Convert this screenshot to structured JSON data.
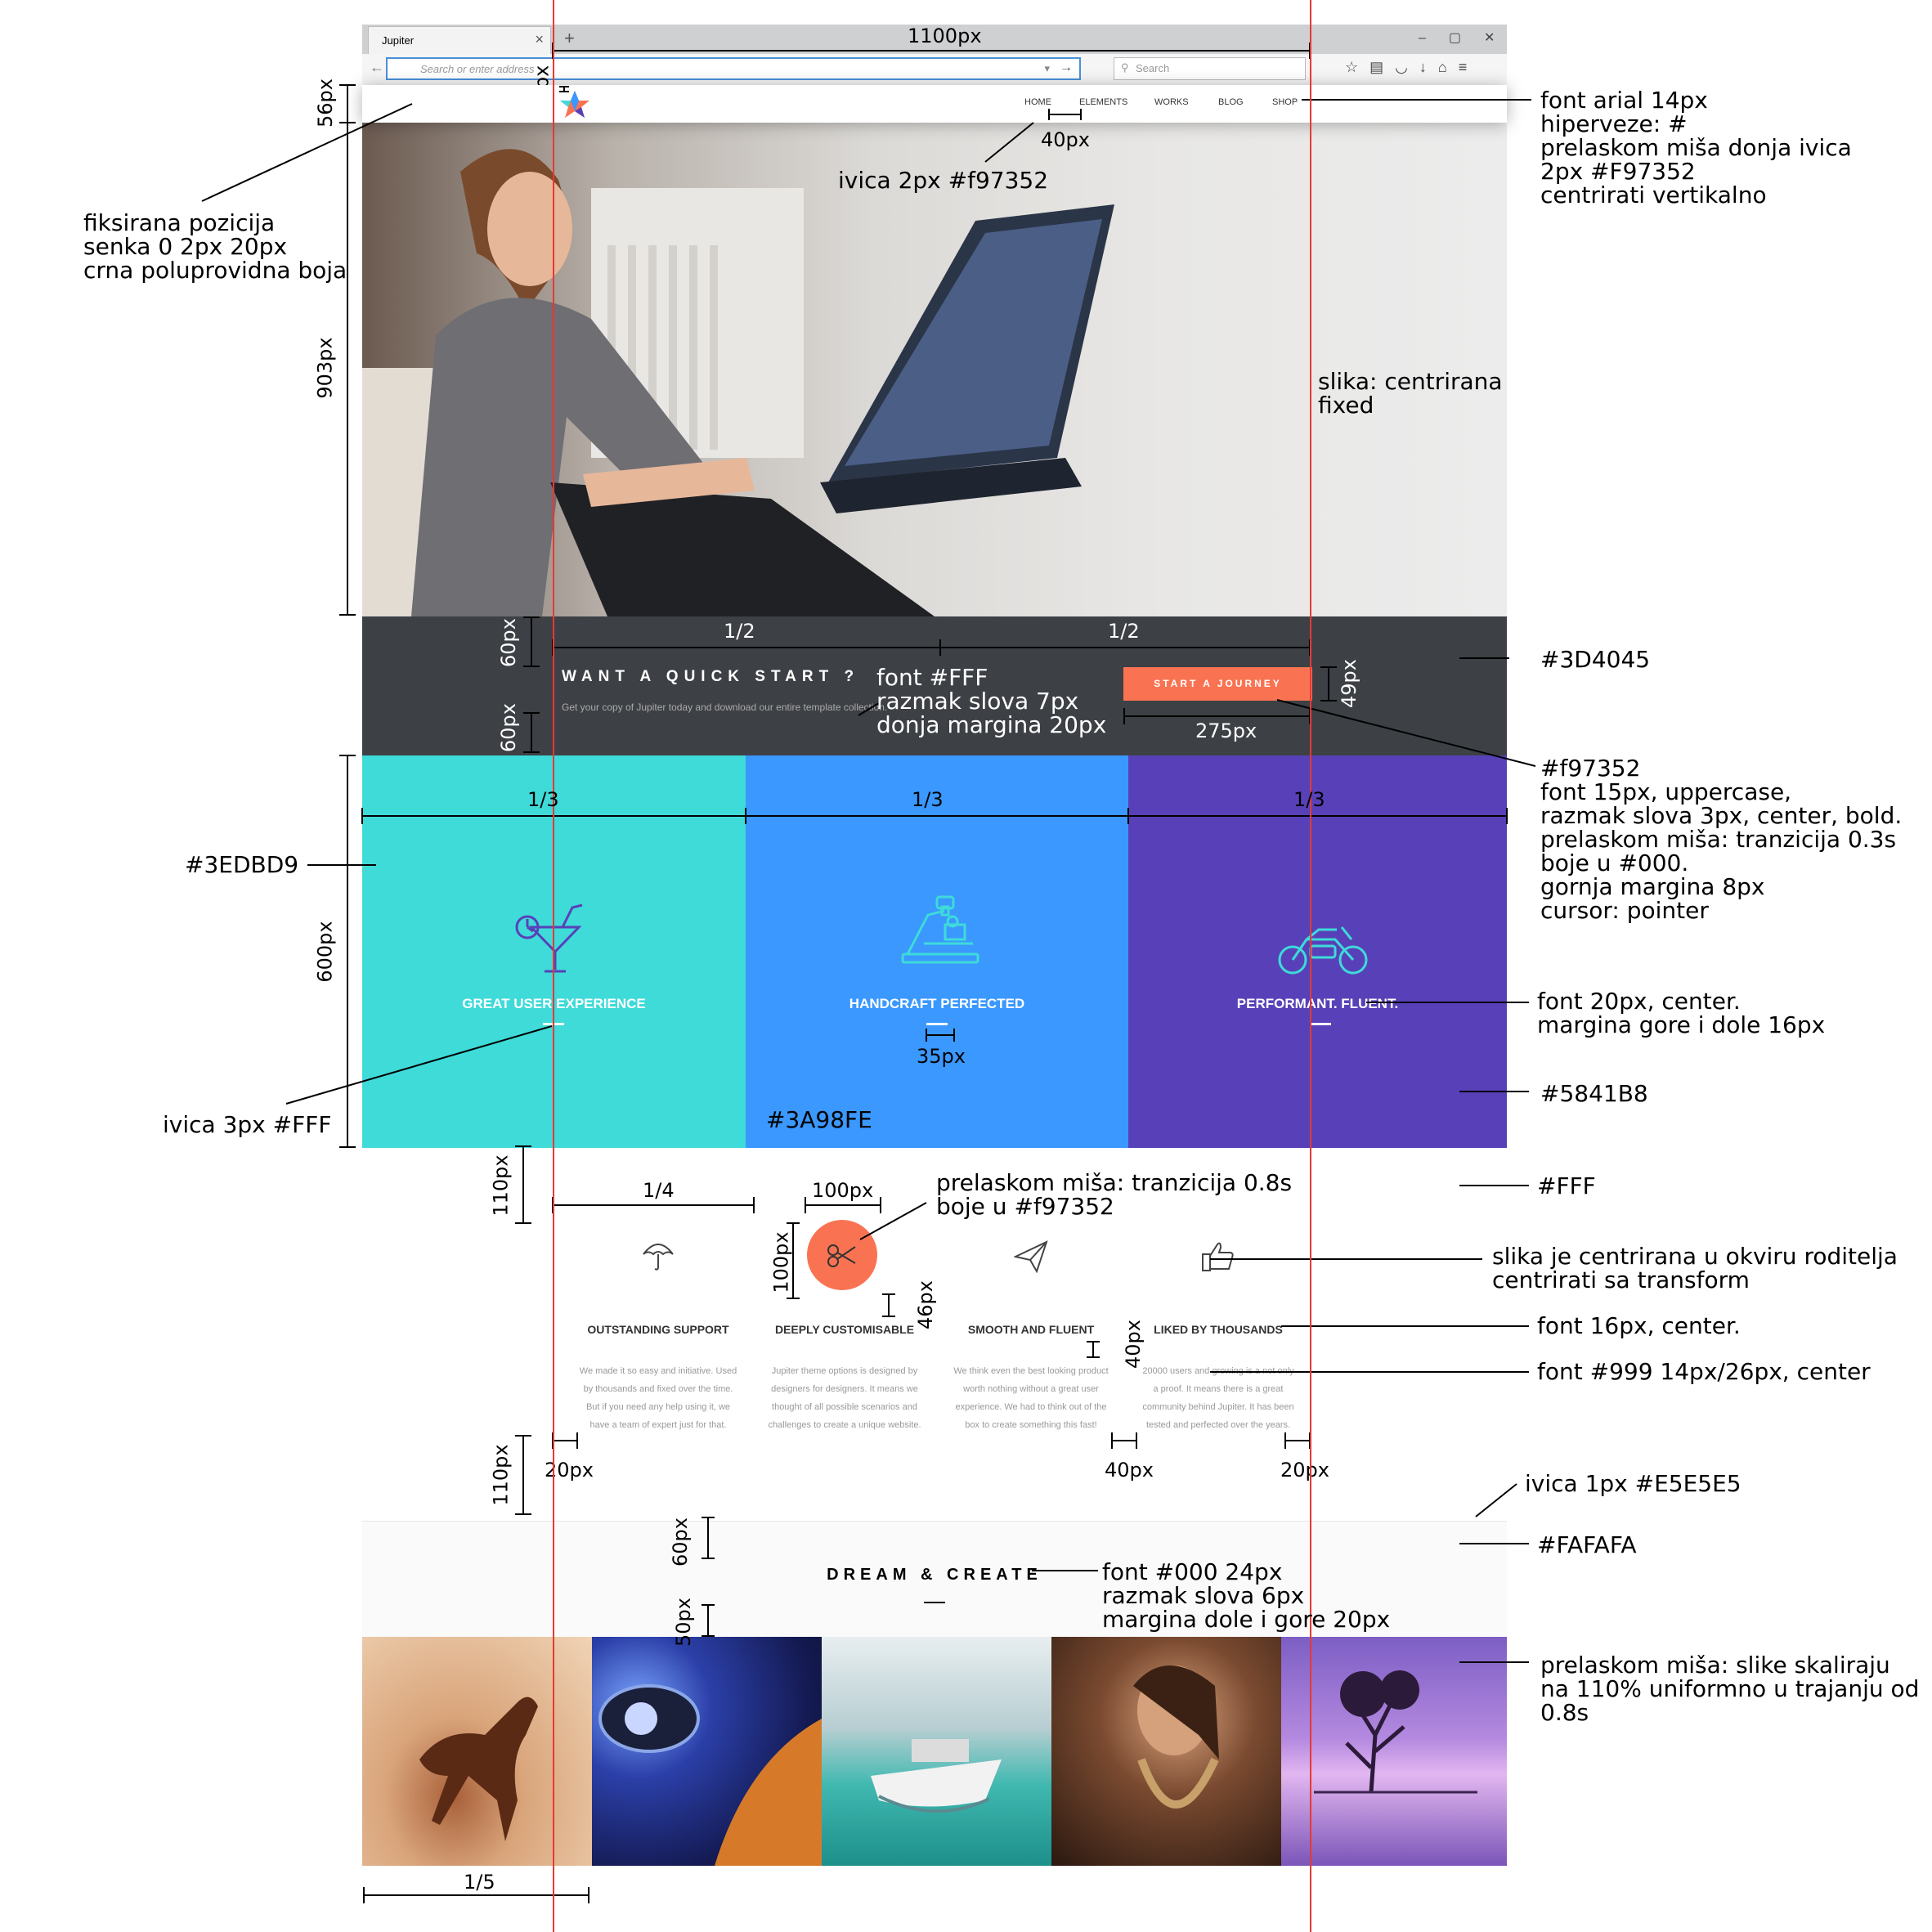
{
  "browser": {
    "tab_title": "Jupiter",
    "tab_close": "×",
    "new_tab": "+",
    "url_placeholder": "Search or enter address",
    "search_placeholder": "Search",
    "window_controls": [
      "–",
      "▢",
      "✕"
    ]
  },
  "site": {
    "nav": [
      "HOME",
      "ELEMENTS",
      "WORKS",
      "BLOG",
      "SHOP"
    ],
    "quick_start": {
      "title": "WANT A QUICK START ?",
      "subtitle": "Get your copy of Jupiter today and download our entire template collection.",
      "button": "START A JOURNEY"
    },
    "columns": [
      {
        "title": "GREAT USER EXPERIENCE",
        "icon": "cocktail-icon"
      },
      {
        "title": "HANDCRAFT PERFECTED",
        "icon": "microscope-icon"
      },
      {
        "title": "PERFORMANT. FLUENT.",
        "icon": "motorcycle-icon"
      }
    ],
    "features": [
      {
        "icon": "umbrella-icon",
        "title": "OUTSTANDING SUPPORT",
        "text": "We made it so easy and initiative. Used\nby thousands and fixed over the time.\nBut if you need any help using it, we\nhave a team of expert just for that."
      },
      {
        "icon": "scissors-icon",
        "title": "DEEPLY CUSTOMISABLE",
        "text": "Jupiter theme options is designed by\ndesigners for designers. It means we\nthought of all possible scenarios and\nchallenges to create a unique website."
      },
      {
        "icon": "paper-plane-icon",
        "title": "SMOOTH AND FLUENT",
        "text": "We think even the best looking product\nworth nothing without a great user\nexperience. We had to think out of the\nbox to create something this fast!"
      },
      {
        "icon": "thumbs-up-icon",
        "title": "LIKED BY THOUSANDS",
        "text": "20000 users and growing is a not only\na proof. It means there is a great\ncommunity behind Jupiter. It has been\ntested and perfected over the years."
      }
    ],
    "dream_title": "DREAM & CREATE",
    "gallery": [
      "horse",
      "car-headlight",
      "boat",
      "woman-rope",
      "purple-tree"
    ]
  },
  "annotations": {
    "width_1100": "1100px",
    "h56": "56px",
    "h4": "4px",
    "h903": "903px",
    "fixed": "fiksirana pozicija\nsenka 0 2px 20px\ncrna poluprovidna boja",
    "nav_font": "font arial 14px\nhiperveze: #\nprelaskom miša donja ivica\n2px #F97352\ncentrirati vertikalno",
    "nav_gap": "40px",
    "nav_border": "ivica 2px #f97352",
    "hero_img": "slika: centrirana\nfixed",
    "half": "1/2",
    "h60a": "60px",
    "h60b": "60px",
    "h49": "49px",
    "w275": "275px",
    "dark_color": "#3D4045",
    "qs_font": "font #FFF\nrazmak slova 7px\ndonja margina 20px",
    "button_spec": "#f97352\nfont 15px, uppercase,\nrazmak slova 3px, center, bold.\nprelaskom miša: tranzicija 0.3s\nboje u #000.\ngornja margina 8px\ncursor: pointer",
    "third": "1/3",
    "c1_color": "#3EDBD9",
    "h600": "600px",
    "col_font": "font 20px, center.\nmargina gore i dole 16px",
    "w35": "35px",
    "c2_color": "#3A98FE",
    "c3_color": "#5841B8",
    "border3": "ivica 3px #FFF",
    "h110a": "110px",
    "quarter": "1/4",
    "w100": "100px",
    "hover_circle": "prelaskom miša: tranzicija 0.8s\nboje u #f97352",
    "fff": "#FFF",
    "h100": "100px",
    "h46": "46px",
    "img_center": "slika je centrirana u okviru roditelja\ncentrirati sa transform",
    "feat_title_font": "font 16px, center.",
    "h40": "40px",
    "feat_text_font": "font #999 14px/26px, center",
    "w20a": "20px",
    "w40": "40px",
    "w20b": "20px",
    "h110b": "110px",
    "border1": "ivica 1px #E5E5E5",
    "fafafa": "#FAFAFA",
    "h60c": "60px",
    "h50": "50px",
    "dream_font": "font #000 24px\nrazmak slova 6px\nmargina dole i gore 20px",
    "gallery_hover": "prelaskom miša: slike skaliraju\nna 110% uniformno u trajanju od\n0.8s",
    "fifth": "1/5"
  }
}
